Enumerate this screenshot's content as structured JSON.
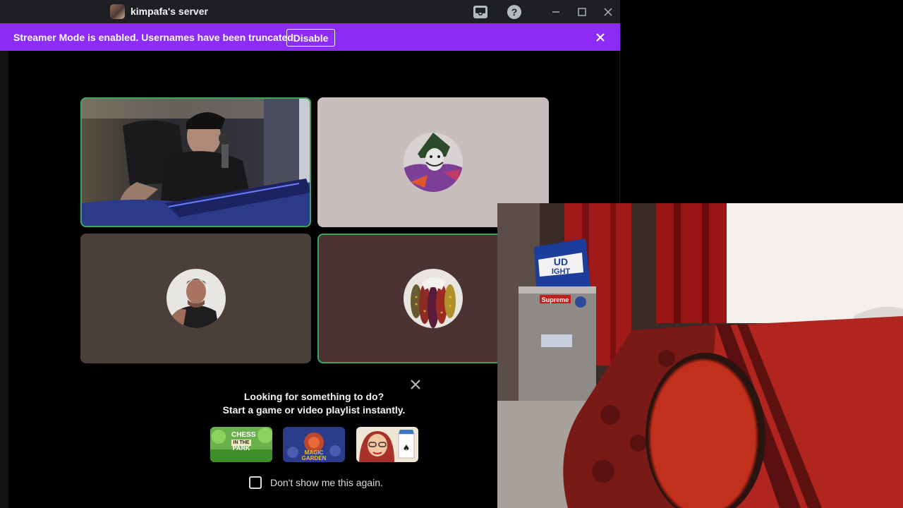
{
  "titlebar": {
    "server_name": "kimpafa's server",
    "icons": [
      "inbox-icon",
      "help-icon",
      "minimize-icon",
      "maximize-icon",
      "close-icon"
    ]
  },
  "banner": {
    "message": "Streamer Mode is enabled. Usernames have been truncated.",
    "disable_label": "Disable",
    "color": "#8c2cf6"
  },
  "call": {
    "speaking_color": "#3ba55c",
    "tiles": [
      {
        "kind": "camera",
        "speaking": true
      },
      {
        "kind": "avatar",
        "speaking": false
      },
      {
        "kind": "avatar",
        "speaking": false
      },
      {
        "kind": "avatar",
        "speaking": true
      }
    ]
  },
  "activity_popup": {
    "line1": "Looking for something to do?",
    "line2": "Start a game or video playlist instantly.",
    "activities": [
      {
        "title_top": "CHESS",
        "title_mid": "IN THE",
        "title_bot": "PARK"
      },
      {
        "title_top": "MAGIC",
        "title_bot": "GARDEN"
      },
      {
        "title_top": "",
        "title_bot": ""
      }
    ],
    "checkbox_label": "Don't show me this again.",
    "checked": false
  },
  "webcam_overlay": {
    "fridge_label": "Supreme",
    "box_text_top": "UD",
    "box_text_bot": "IGHT"
  }
}
